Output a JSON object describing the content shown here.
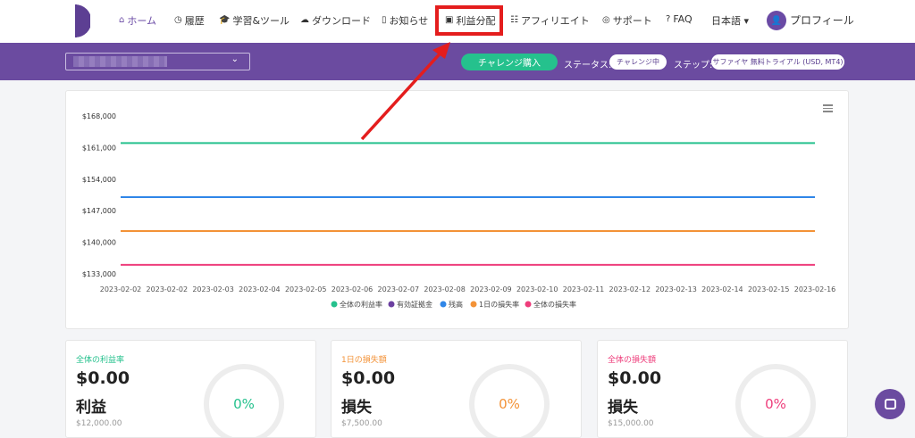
{
  "nav": {
    "items": [
      {
        "label": "ホーム",
        "icon": "home-icon",
        "glyph": "⌂",
        "active": true
      },
      {
        "label": "履歴",
        "icon": "clock-icon",
        "glyph": "◷"
      },
      {
        "label": "学習&ツール",
        "icon": "graduation-cap-icon",
        "glyph": "🎓"
      },
      {
        "label": "ダウンロード",
        "icon": "cloud-download-icon",
        "glyph": "☁"
      },
      {
        "label": "お知らせ",
        "icon": "document-icon",
        "glyph": "▯"
      },
      {
        "label": "利益分配",
        "icon": "money-icon",
        "glyph": "▣"
      },
      {
        "label": "アフィリエイト",
        "icon": "users-icon",
        "glyph": "☷"
      },
      {
        "label": "サポート",
        "icon": "headset-icon",
        "glyph": "◎"
      },
      {
        "label": "FAQ",
        "icon": "question-icon",
        "glyph": "?"
      }
    ],
    "language": "日本語",
    "language_caret": "▾",
    "profile": "プロフィール",
    "avatar_glyph": "👤"
  },
  "toolbar": {
    "account_chevron": "⌄",
    "challenge_button": "チャレンジ購入",
    "status_label": "ステータス:",
    "status_value": "チャレンジ中",
    "step_label": "ステップ:",
    "step_value": "サファイヤ 無料トライアル (USD, MT4)"
  },
  "colors": {
    "brand_purple": "#6b4ba0",
    "accent_green": "#25c18d",
    "highlight_red": "#e41d1d"
  },
  "chart_data": {
    "type": "line",
    "y_ticks": [
      "$168,000",
      "$161,000",
      "$154,000",
      "$147,000",
      "$140,000",
      "$133,000"
    ],
    "ylim": [
      133000,
      168000
    ],
    "x": [
      "2023-02-02",
      "2023-02-02",
      "2023-02-03",
      "2023-02-04",
      "2023-02-05",
      "2023-02-06",
      "2023-02-07",
      "2023-02-08",
      "2023-02-09",
      "2023-02-10",
      "2023-02-11",
      "2023-02-12",
      "2023-02-13",
      "2023-02-14",
      "2023-02-15",
      "2023-02-16"
    ],
    "series": [
      {
        "name": "全体の利益率",
        "color": "#25c18d",
        "value": 162000
      },
      {
        "name": "有効証拠金",
        "color": "#6b3fa0",
        "value": null
      },
      {
        "name": "残高",
        "color": "#2f86e8",
        "value": 150000
      },
      {
        "name": "1日の損失率",
        "color": "#f39237",
        "value": 142500
      },
      {
        "name": "全体の損失率",
        "color": "#ee3d7b",
        "value": 135000
      }
    ],
    "grid": false,
    "legend_position": "bottom"
  },
  "stats": [
    {
      "title": "全体の利益率",
      "amount": "$0.00",
      "label": "利益",
      "sub": "$12,000.00",
      "percent": "0%",
      "color": "#25c18d"
    },
    {
      "title": "1日の損失額",
      "amount": "$0.00",
      "label": "損失",
      "sub": "$7,500.00",
      "percent": "0%",
      "color": "#f39237"
    },
    {
      "title": "全体の損失額",
      "amount": "$0.00",
      "label": "損失",
      "sub": "$15,000.00",
      "percent": "0%",
      "color": "#ee3d7b"
    }
  ]
}
